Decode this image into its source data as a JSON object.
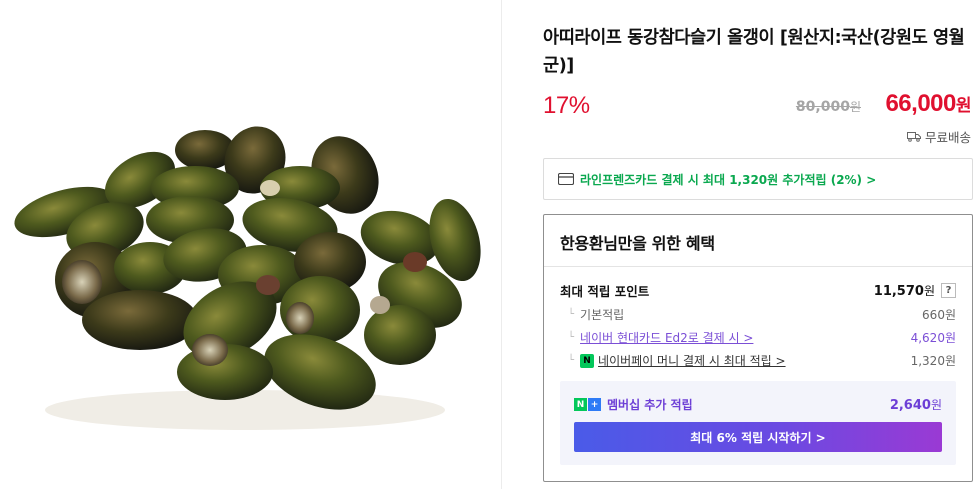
{
  "product": {
    "title": "아띠라이프 동강참다슬기 올갱이 [원산지:국산(강원도 영월군)]",
    "image_alt": "다슬기 상품 이미지"
  },
  "price": {
    "discount": "17%",
    "original": "80,000",
    "original_unit": "원",
    "sale": "66,000",
    "sale_unit": "원",
    "shipping": "무료배송"
  },
  "card_promo": {
    "text": "라인프렌즈카드 결제 시 최대 1,320원 추가적립 (2%) >"
  },
  "benefit": {
    "heading": "한용환님만을 위한 혜택",
    "max_point_label": "최대 적립 포인트",
    "max_point_value": "11,570",
    "max_point_unit": "원",
    "help": "?",
    "items": [
      {
        "label": "기본적립",
        "value": "660원"
      },
      {
        "label": "네이버 현대카드 Ed2로 결제 시 >",
        "value": "4,620원"
      },
      {
        "label": "네이버페이 머니 결제 시 최대 적립 >",
        "value": "1,320원"
      }
    ],
    "membership": {
      "label": "멤버십 추가 적립",
      "value": "2,640",
      "unit": "원",
      "button": "최대 6% 적립 시작하기 >"
    }
  },
  "colors": {
    "accent_red": "#e0102f",
    "naver_green": "#03c75a",
    "membership_purple": "#6d3fd6"
  }
}
